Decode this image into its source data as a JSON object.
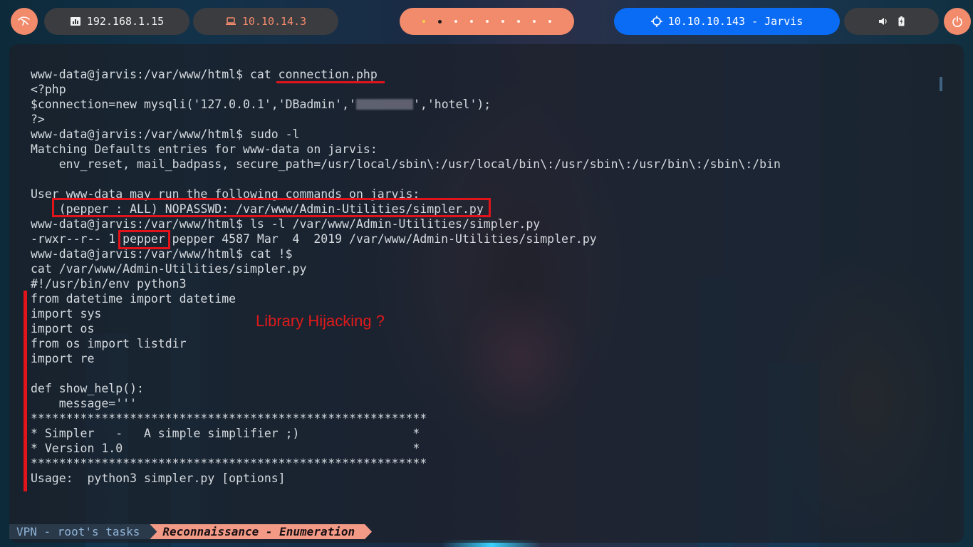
{
  "topbar": {
    "kali_icon": "kali-dragon-icon",
    "target_ip": "192.168.1.15",
    "vpn_ip": "10.10.14.3",
    "workspaces": 9,
    "active_workspace": 2,
    "machine": "10.10.10.143 - Jarvis",
    "power_icon": "power-icon",
    "colors": {
      "orange": "#f28a6c",
      "blue": "#0a6cf5",
      "dark": "#3a3c40"
    }
  },
  "terminal": {
    "lines": [
      "www-data@jarvis:/var/www/html$ cat connection.php",
      "<?php",
      "$connection=new mysqli('127.0.0.1','DBadmin','",
      "?>",
      "www-data@jarvis:/var/www/html$ sudo -l",
      "Matching Defaults entries for www-data on jarvis:",
      "    env_reset, mail_badpass, secure_path=/usr/local/sbin\\:/usr/local/bin\\:/usr/sbin\\:/usr/bin\\:/sbin\\:/bin",
      "",
      "User www-data may run the following commands on jarvis:",
      "    (pepper : ALL) NOPASSWD: /var/www/Admin-Utilities/simpler.py",
      "www-data@jarvis:/var/www/html$ ls -l /var/www/Admin-Utilities/simpler.py",
      "-rwxr--r-- 1 pepper pepper 4587 Mar  4  2019 /var/www/Admin-Utilities/simpler.py",
      "www-data@jarvis:/var/www/html$ cat !$",
      "cat /var/www/Admin-Utilities/simpler.py",
      "#!/usr/bin/env python3",
      "from datetime import datetime",
      "import sys",
      "import os",
      "from os import listdir",
      "import re",
      "",
      "def show_help():",
      "    message='''",
      "********************************************************",
      "* Simpler   -   A simple simplifier ;)                *",
      "* Version 1.0                                         *",
      "********************************************************",
      "Usage:  python3 simpler.py [options]"
    ],
    "line3_tail": "','hotel');",
    "annotation": "Library Hijacking ?"
  },
  "statusbar": {
    "vpn": "VPN - root's tasks",
    "current": "Reconnaissance - Enumeration"
  }
}
